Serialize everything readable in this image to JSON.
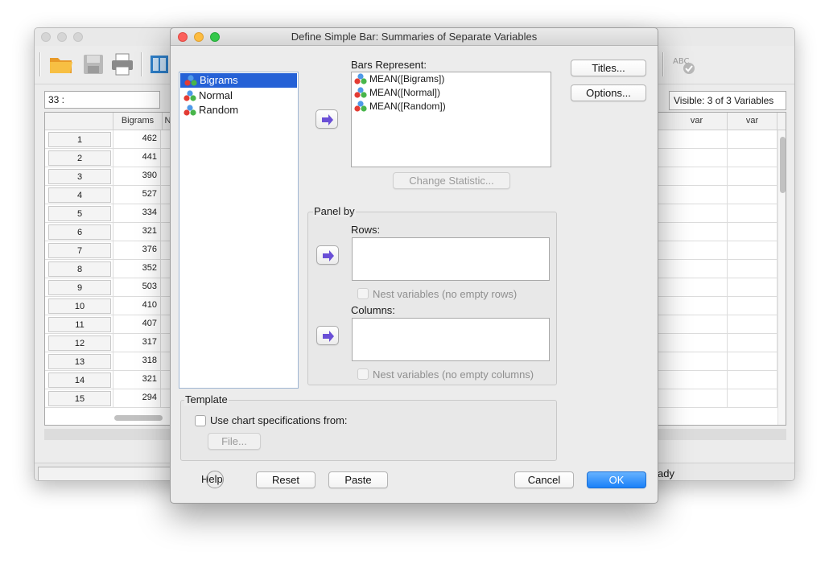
{
  "editor": {
    "cell_reference": "33 :",
    "visible_vars": "Visible: 3 of 3 Variables",
    "columns": [
      "Bigrams",
      "N",
      "var",
      "var"
    ],
    "rows": [
      {
        "n": "1",
        "v": "462"
      },
      {
        "n": "2",
        "v": "441"
      },
      {
        "n": "3",
        "v": "390"
      },
      {
        "n": "4",
        "v": "527"
      },
      {
        "n": "5",
        "v": "334"
      },
      {
        "n": "6",
        "v": "321"
      },
      {
        "n": "7",
        "v": "376"
      },
      {
        "n": "8",
        "v": "352"
      },
      {
        "n": "9",
        "v": "503"
      },
      {
        "n": "10",
        "v": "410"
      },
      {
        "n": "11",
        "v": "407"
      },
      {
        "n": "12",
        "v": "317"
      },
      {
        "n": "13",
        "v": "318"
      },
      {
        "n": "14",
        "v": "321"
      },
      {
        "n": "15",
        "v": "294"
      }
    ],
    "status": "ady"
  },
  "dialog": {
    "title": "Define Simple Bar: Summaries of Separate Variables",
    "source_vars": [
      "Bigrams",
      "Normal",
      "Random"
    ],
    "selected_var": "Bigrams",
    "bars_represent_label": "Bars Represent:",
    "bars_represent_items": [
      "MEAN([Bigrams])",
      "MEAN([Normal])",
      "MEAN([Random])"
    ],
    "change_statistic": "Change Statistic...",
    "titles_btn": "Titles...",
    "options_btn": "Options...",
    "panel_by": {
      "title": "Panel by",
      "rows_label": "Rows:",
      "nest_rows": "Nest variables (no empty rows)",
      "columns_label": "Columns:",
      "nest_columns": "Nest variables (no empty columns)"
    },
    "template": {
      "title": "Template",
      "use_spec": "Use chart specifications from:",
      "file_btn": "File..."
    },
    "buttons": {
      "help": "Help",
      "reset": "Reset",
      "paste": "Paste",
      "cancel": "Cancel",
      "ok": "OK"
    }
  },
  "colors": {
    "accent": "#1a80f8",
    "selection": "#2561d6",
    "arrow": "#6a4fd6"
  }
}
